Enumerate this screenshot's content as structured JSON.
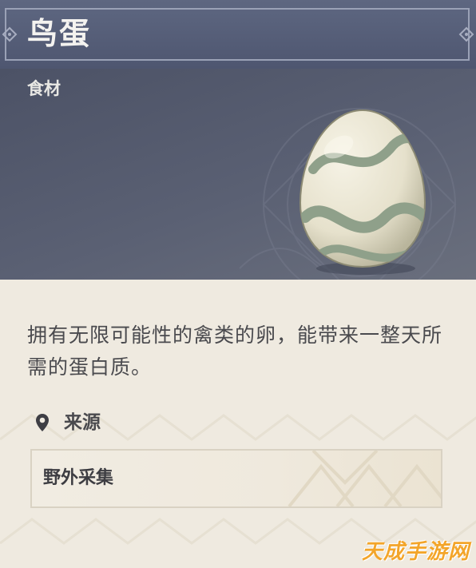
{
  "item": {
    "name": "鸟蛋",
    "category": "食材",
    "icon": "bird-egg-image",
    "description": "拥有无限可能性的禽类的卵，能带来一整天所需的蛋白质。"
  },
  "source": {
    "label": "来源",
    "icon": "location-pin-icon",
    "value": "野外采集"
  },
  "watermark": "天成手游网",
  "colors": {
    "title_bar": "#5a6279",
    "header": "#555b6e",
    "body": "#efeae0",
    "text_dark": "#4a4a4e",
    "watermark": "#f3a52a"
  }
}
